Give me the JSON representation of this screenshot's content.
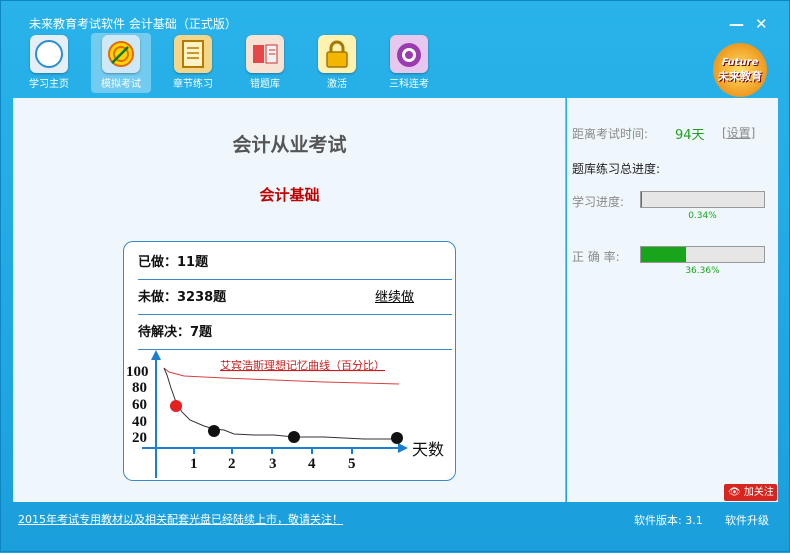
{
  "window": {
    "title": "未来教育考试软件 会计基础（正式版）",
    "minimize_glyph": "—",
    "close_glyph": "✕"
  },
  "toolbar": {
    "items": [
      {
        "label": "学习主页",
        "icon": "compass-icon"
      },
      {
        "label": "模拟考试",
        "icon": "target-icon"
      },
      {
        "label": "章节练习",
        "icon": "notebook-icon"
      },
      {
        "label": "错题库",
        "icon": "book-icon"
      },
      {
        "label": "激活",
        "icon": "lock-icon"
      },
      {
        "label": "三科连考",
        "icon": "bag-icon"
      }
    ],
    "active_index": 1
  },
  "logo": {
    "en": "Future",
    "cn": "未来教育"
  },
  "main": {
    "exam_title": "会计从业考试",
    "subject": "会计基础",
    "done": "已做：11题",
    "undone": "未做：3238题",
    "continue_label": "继续做",
    "pending": "待解决：7题",
    "curve": {
      "title": "艾宾浩斯理想记忆曲线（百分比）",
      "x_label": "天数",
      "y_ticks": [
        "100",
        "80",
        "60",
        "40",
        "20"
      ],
      "x_ticks": [
        "1",
        "2",
        "3",
        "4",
        "5"
      ]
    }
  },
  "side": {
    "countdown_label": "距离考试时间:",
    "countdown_value": "94天",
    "settings_label": "[设置]",
    "section_title": "题库练习总进度:",
    "progress_label": "学习进度:",
    "progress_value": 0.0034,
    "progress_text": "0.34%",
    "accuracy_label": "正 确 率:",
    "accuracy_value": 0.3636,
    "accuracy_text": "36.36%"
  },
  "status": {
    "notice": "2015年考试专用教材以及相关配套光盘已经陆续上市，敬请关注！",
    "version": "软件版本: 3.1",
    "upgrade": "软件升级",
    "follow": "加关注"
  },
  "colors": {
    "accent": "#1aa6e0",
    "green": "#19a51b",
    "red": "#c00000"
  }
}
